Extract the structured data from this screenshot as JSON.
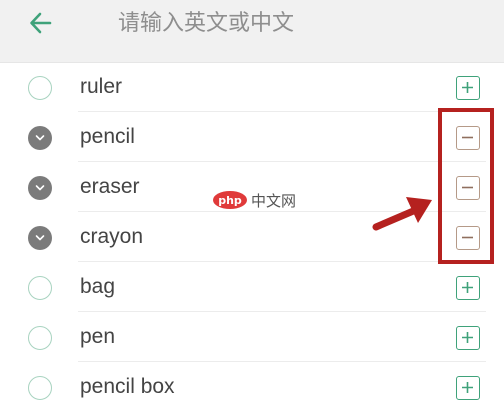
{
  "header": {
    "back_icon": "arrow-left-icon",
    "search_placeholder": "请输入英文或中文",
    "accent_color": "#3fa27a"
  },
  "list": {
    "items": [
      {
        "word": "ruler",
        "selected": false,
        "action": "add"
      },
      {
        "word": "pencil",
        "selected": true,
        "action": "remove"
      },
      {
        "word": "eraser",
        "selected": true,
        "action": "remove"
      },
      {
        "word": "crayon",
        "selected": true,
        "action": "remove"
      },
      {
        "word": "bag",
        "selected": false,
        "action": "add"
      },
      {
        "word": "pen",
        "selected": false,
        "action": "add"
      },
      {
        "word": "pencil box",
        "selected": false,
        "action": "add"
      }
    ]
  },
  "annotation": {
    "highlight_color": "#b5211f"
  },
  "watermark": {
    "logo_text": "php",
    "site_text": "中文网"
  }
}
